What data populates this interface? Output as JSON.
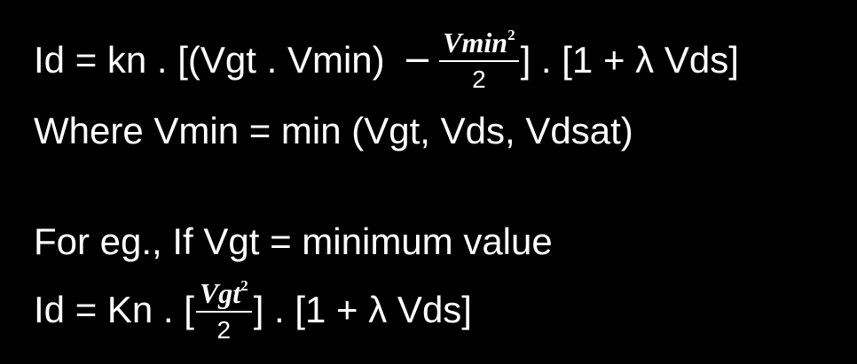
{
  "equations": {
    "line1": {
      "lhs": "Id = kn . [(Vgt . Vmin)",
      "minus": "−",
      "frac_num": "Vmin",
      "frac_exp": "2",
      "frac_den": "2",
      "rhs": "] . [1 + λ Vds]"
    },
    "line2": {
      "text": "Where Vmin = min (Vgt, Vds, Vdsat)"
    },
    "line3": {
      "text": "For eg., If Vgt = minimum value"
    },
    "line4": {
      "lhs": "Id = Kn . [",
      "frac_num": "Vgt",
      "frac_exp": "2",
      "frac_den": "2",
      "rhs": "] . [1 + λ Vds]"
    }
  }
}
